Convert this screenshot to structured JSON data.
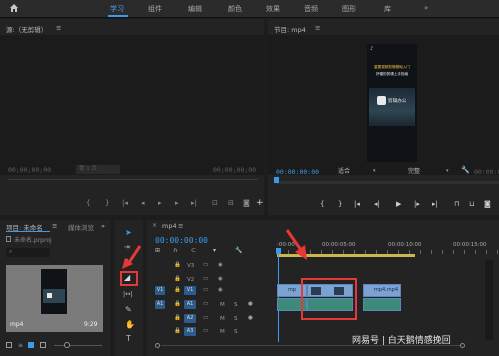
{
  "workspace": {
    "tabs": [
      "学习",
      "组件",
      "编辑",
      "颜色",
      "效果",
      "音频",
      "图形",
      "库"
    ],
    "active_tab": "学习",
    "more": "»"
  },
  "source_monitor": {
    "title": "源:（无剪辑）",
    "menu": "≡",
    "timecode_left": "00;00;00;00",
    "page_label": "第 1 页",
    "timecode_right": "00;00;00;00"
  },
  "program_monitor": {
    "title": "节目: mp4",
    "menu": "≡",
    "timecode": "00:00:00:00",
    "fit": "适合",
    "quality": "完整",
    "timecode_right": "00:00:00:00",
    "video_caption_top": "重要视频剪辑基础入门",
    "video_caption_sub": "好懂的剪辑上手指南",
    "video_logo_text": "剪辑办公"
  },
  "project_panel": {
    "tab_project": "项目: 未命名",
    "tab_media": "媒体浏览",
    "more": "»",
    "file": "未命名.prproj",
    "clip_name": "mp4",
    "clip_duration": "9:29"
  },
  "timeline": {
    "tab": "mp4",
    "menu": "≡",
    "timecode": "00:00:00:00",
    "ruler": [
      ":00:00",
      "00:00:05:00",
      "00:00:10:00",
      "00:00:15:00"
    ],
    "tracks": [
      {
        "name": "V3",
        "type": "video"
      },
      {
        "name": "V2",
        "type": "video"
      },
      {
        "name": "V1",
        "type": "video",
        "target": "V1"
      },
      {
        "name": "A1",
        "type": "audio",
        "target": "A1"
      },
      {
        "name": "A2",
        "type": "audio"
      },
      {
        "name": "A3",
        "type": "audio"
      }
    ],
    "clip_label_1": "mp",
    "clip_label_2": "mp4.mp4"
  },
  "watermark": "网易号 | 白天鹅情感挽回",
  "colors": {
    "accent": "#3d9ae8",
    "highlight": "#e53838",
    "clip": "#7aa3d4",
    "audio_clip": "#3d8a7a"
  }
}
